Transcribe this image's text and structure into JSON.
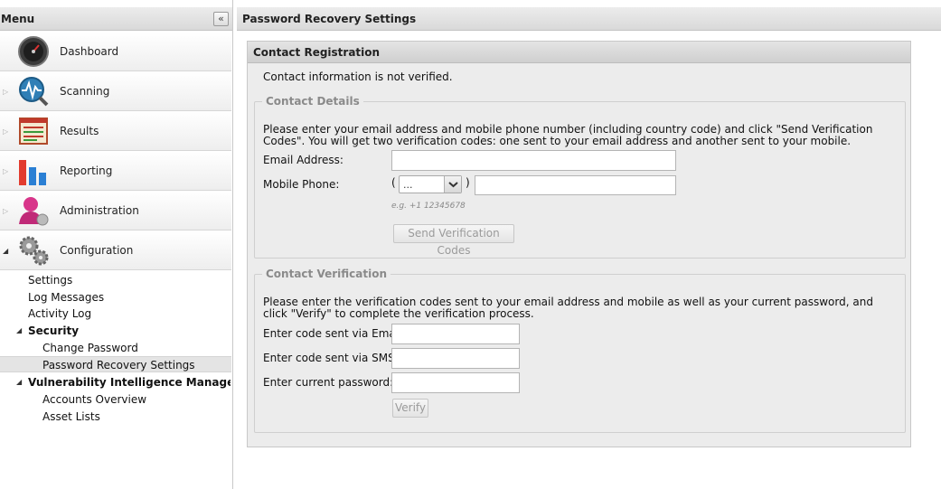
{
  "sidebar": {
    "title": "Menu",
    "collapse_icon": "«",
    "nav": [
      {
        "label": "Dashboard",
        "icon": "dashboard-gauge-icon"
      },
      {
        "label": "Scanning",
        "icon": "scanning-radar-icon"
      },
      {
        "label": "Results",
        "icon": "results-report-icon"
      },
      {
        "label": "Reporting",
        "icon": "reporting-chart-icon"
      },
      {
        "label": "Administration",
        "icon": "administration-user-icon"
      },
      {
        "label": "Configuration",
        "icon": "configuration-gears-icon"
      }
    ],
    "tree": {
      "settings": "Settings",
      "log_messages": "Log Messages",
      "activity_log": "Activity Log",
      "security": "Security",
      "change_password": "Change Password",
      "password_recovery": "Password Recovery Settings",
      "vim": "Vulnerability Intelligence Manager Inte",
      "accounts_overview": "Accounts Overview",
      "asset_lists": "Asset Lists"
    }
  },
  "main": {
    "title": "Password Recovery Settings",
    "panel_title": "Contact Registration",
    "status": "Contact information is not verified.",
    "contact_details": {
      "legend": "Contact Details",
      "instructions": "Please enter your email address and mobile phone number (including country code) and click \"Send Verification Codes\". You will get two verification codes: one sent to your email address and another sent to your mobile.",
      "email_label": "Email Address:",
      "email_value": "",
      "phone_label": "Mobile Phone:",
      "paren_open": "(",
      "paren_close": ")",
      "country_code_value": "...",
      "phone_value": "",
      "phone_hint": "e.g. +1 12345678",
      "send_button": "Send Verification Codes"
    },
    "contact_verification": {
      "legend": "Contact Verification",
      "instructions": "Please enter the verification codes sent to your email address and mobile as well as your current password, and click \"Verify\" to complete the verification process.",
      "email_code_label": "Enter code sent via Email:",
      "sms_code_label": "Enter code sent via SMS:",
      "password_label": "Enter current password:",
      "verify_button": "Verify"
    }
  }
}
